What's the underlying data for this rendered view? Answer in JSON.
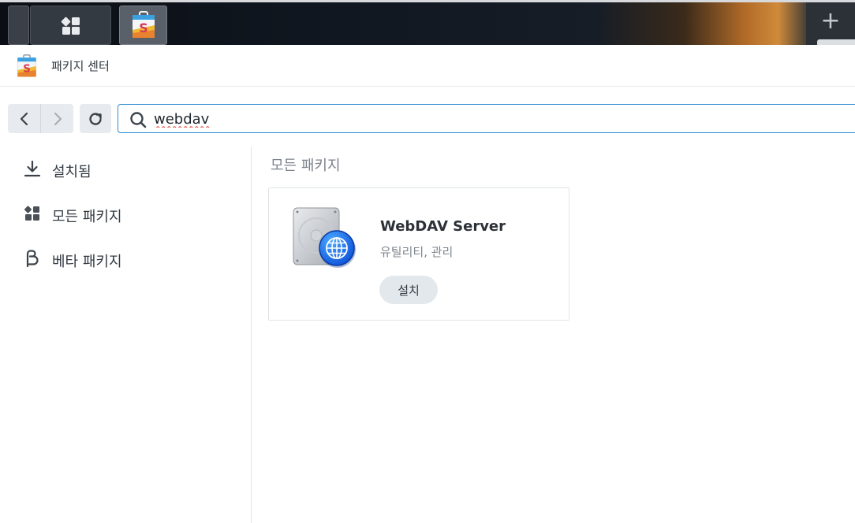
{
  "taskbar": {
    "main_menu_icon": "grid-apps-icon",
    "active_app_icon": "package-center-icon",
    "add_icon": "plus-icon",
    "add_symbol": "+"
  },
  "window": {
    "title": "패키지 센터",
    "icon": "package-center-icon"
  },
  "toolbar": {
    "back_icon": "chevron-left-icon",
    "forward_icon": "chevron-right-icon",
    "refresh_icon": "refresh-icon",
    "search": {
      "value": "webdav",
      "icon": "search-icon"
    }
  },
  "sidebar": {
    "items": [
      {
        "label": "설치됨",
        "icon": "download-icon"
      },
      {
        "label": "모든 패키지",
        "icon": "grid-apps-icon"
      },
      {
        "label": "베타 패키지",
        "icon": "beta-icon"
      }
    ]
  },
  "main": {
    "section_title": "모든 패키지",
    "packages": [
      {
        "name": "WebDAV Server",
        "category": "유틸리티, 관리",
        "action_label": "설치",
        "icon": "webdav-server-icon"
      }
    ]
  },
  "colors": {
    "accent": "#2c8cd6",
    "button_bg": "#e3e8ec",
    "sidebar_border": "#e3e6e9"
  }
}
